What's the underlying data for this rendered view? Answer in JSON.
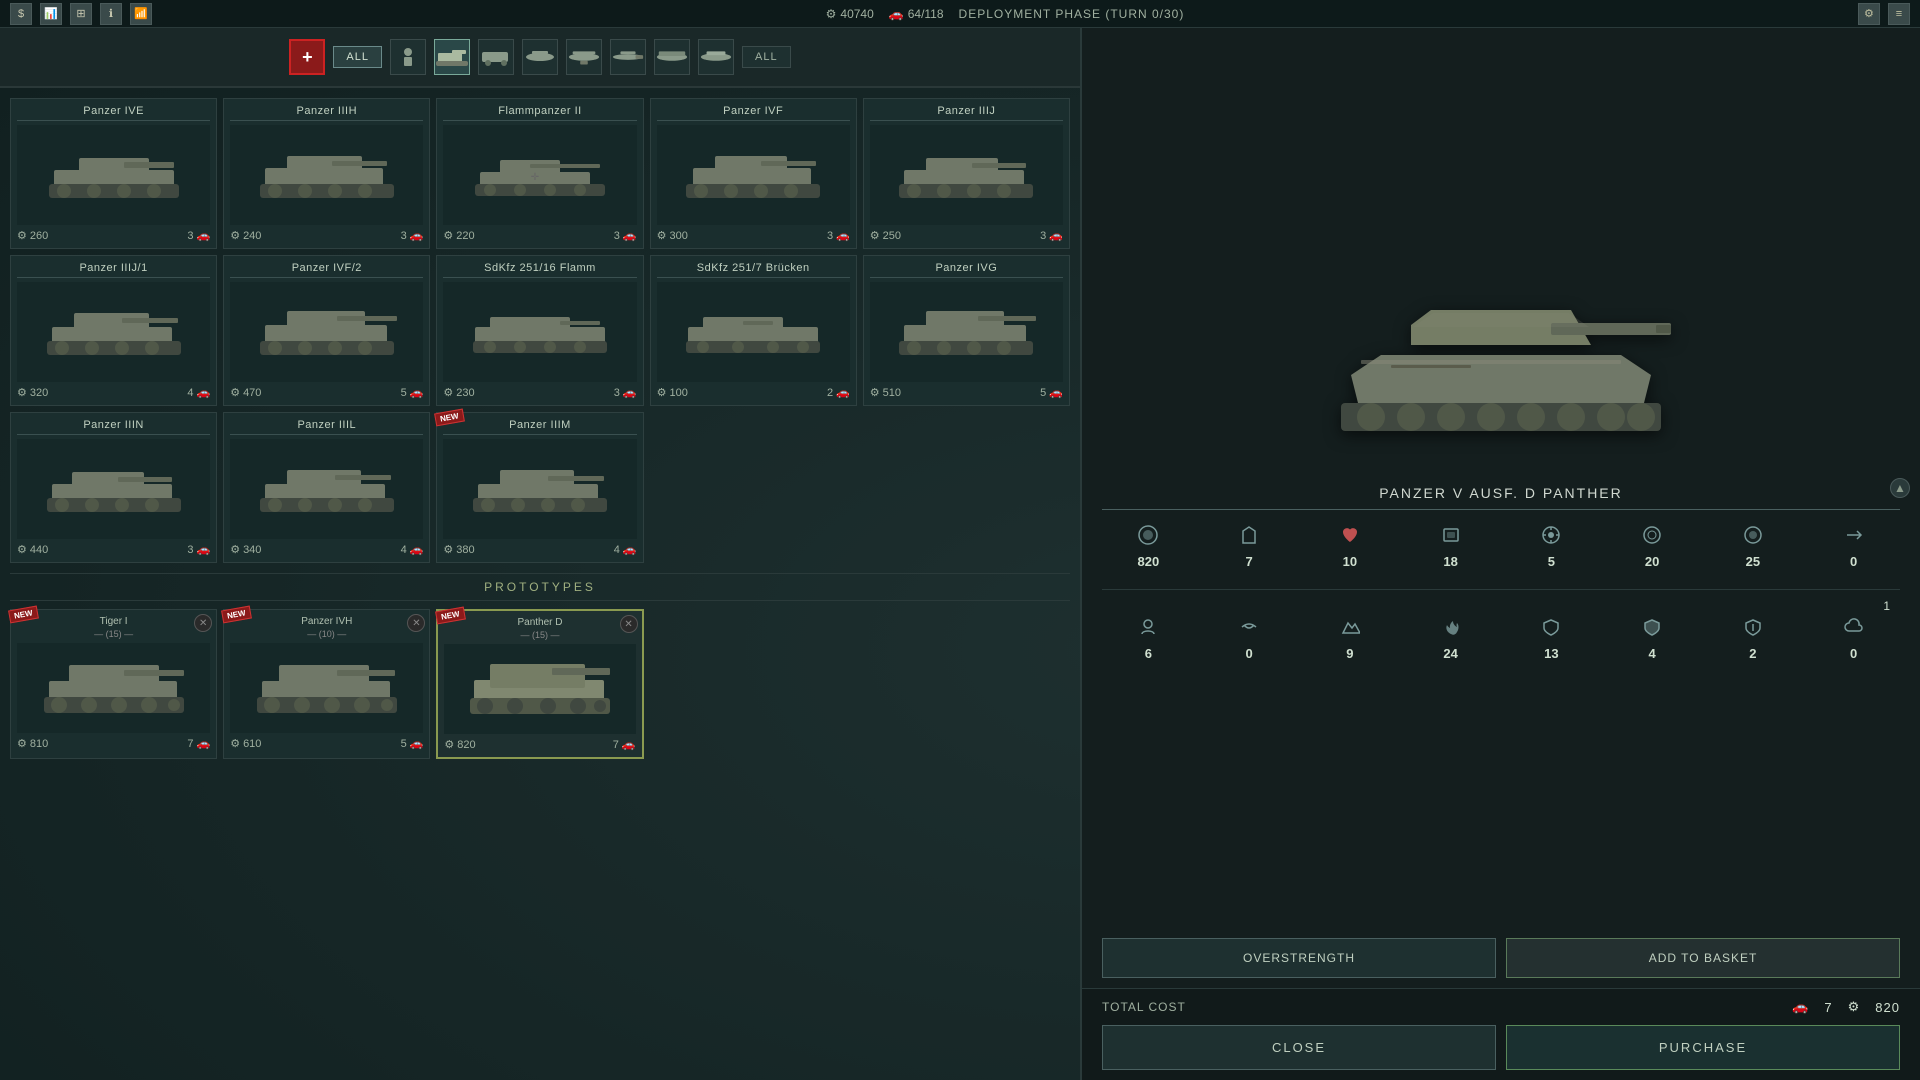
{
  "topbar": {
    "icons": [
      "$",
      "📊",
      "⊞",
      "ℹ",
      "📶"
    ],
    "resources": {
      "supply": "40740",
      "units": "64/118"
    },
    "deployment": "DEPLOYMENT PHASE (TURN 0/30)",
    "settings_icon": "⚙",
    "menu_icon": "≡"
  },
  "filterbar": {
    "faction": "+",
    "all_label": "ALL",
    "unit_types": [
      "infantry",
      "tank",
      "vehicle",
      "plane",
      "bomber",
      "fighter",
      "support",
      "transport",
      "all"
    ],
    "unit_type_icons": [
      "👤",
      "🚗",
      "🚛",
      "✈",
      "💣",
      "✈",
      "🔧",
      "🚌",
      "ALL"
    ],
    "active_type": "tank"
  },
  "units": [
    {
      "name": "Panzer IVE",
      "cost": 260,
      "supply": 3,
      "row": 1
    },
    {
      "name": "Panzer IIIH",
      "cost": 240,
      "supply": 3,
      "row": 1
    },
    {
      "name": "Flammpanzer II",
      "cost": 220,
      "supply": 3,
      "row": 1
    },
    {
      "name": "Panzer IVF",
      "cost": 300,
      "supply": 3,
      "row": 1
    },
    {
      "name": "Panzer IIIJ",
      "cost": 250,
      "supply": 3,
      "row": 1
    },
    {
      "name": "Panzer IIIJ/1",
      "cost": 320,
      "supply": 4,
      "row": 2
    },
    {
      "name": "Panzer IVF/2",
      "cost": 470,
      "supply": 5,
      "row": 2
    },
    {
      "name": "SdKfz 251/16 Flamm",
      "cost": 230,
      "supply": 3,
      "row": 2
    },
    {
      "name": "SdKfz 251/7 Brücken",
      "cost": 100,
      "supply": 2,
      "row": 2
    },
    {
      "name": "Panzer IVG",
      "cost": 510,
      "supply": 5,
      "row": 2
    },
    {
      "name": "Panzer IIIN",
      "cost": 440,
      "supply": 3,
      "row": 3
    },
    {
      "name": "Panzer IIIL",
      "cost": 340,
      "supply": 4,
      "row": 3
    },
    {
      "name": "Panzer IIIM",
      "cost": 380,
      "supply": 4,
      "row": 3,
      "new": true
    }
  ],
  "prototypes": {
    "header": "PROTOTYPES",
    "units": [
      {
        "name": "Tiger I",
        "strength": 15,
        "cost": 810,
        "supply": 7,
        "new": true,
        "selected": false
      },
      {
        "name": "Panzer IVH",
        "strength": 10,
        "cost": 610,
        "supply": 5,
        "new": true,
        "selected": false
      },
      {
        "name": "Panther D",
        "strength": 15,
        "cost": 820,
        "supply": 7,
        "new": true,
        "selected": true
      }
    ]
  },
  "preview": {
    "unit_name": "PANZER V AUSF. D  PANTHER",
    "stats_top": {
      "cost": 820,
      "fuel": 7,
      "health": 10,
      "armor": 18,
      "attack": 5,
      "range": 20,
      "sight": 25,
      "speed": 0,
      "extra": 1
    },
    "stats_bottom": {
      "supply": 6,
      "stealth": 0,
      "terrain": 9,
      "fire": 24,
      "defense": 13,
      "shield": 4,
      "shield2": 2,
      "cloud": 0
    },
    "stat_icons_top": [
      "💰",
      "🚢",
      "♥",
      "🛡",
      "⚔",
      "🎯",
      "👁",
      "⚡",
      "➕"
    ],
    "stat_icons_bottom": [
      "👥",
      "↩",
      "🏔",
      "⚡",
      "🛡",
      "🛡",
      "🛡",
      "☁"
    ]
  },
  "actions": {
    "overstrength_label": "OVERSTRENGTH",
    "add_to_basket_label": "ADD TO BASKET"
  },
  "bottom": {
    "total_cost_label": "TOTAL COST",
    "total_supply": 7,
    "total_cost": 820,
    "close_label": "CLOSE",
    "purchase_label": "PURCHASE"
  }
}
